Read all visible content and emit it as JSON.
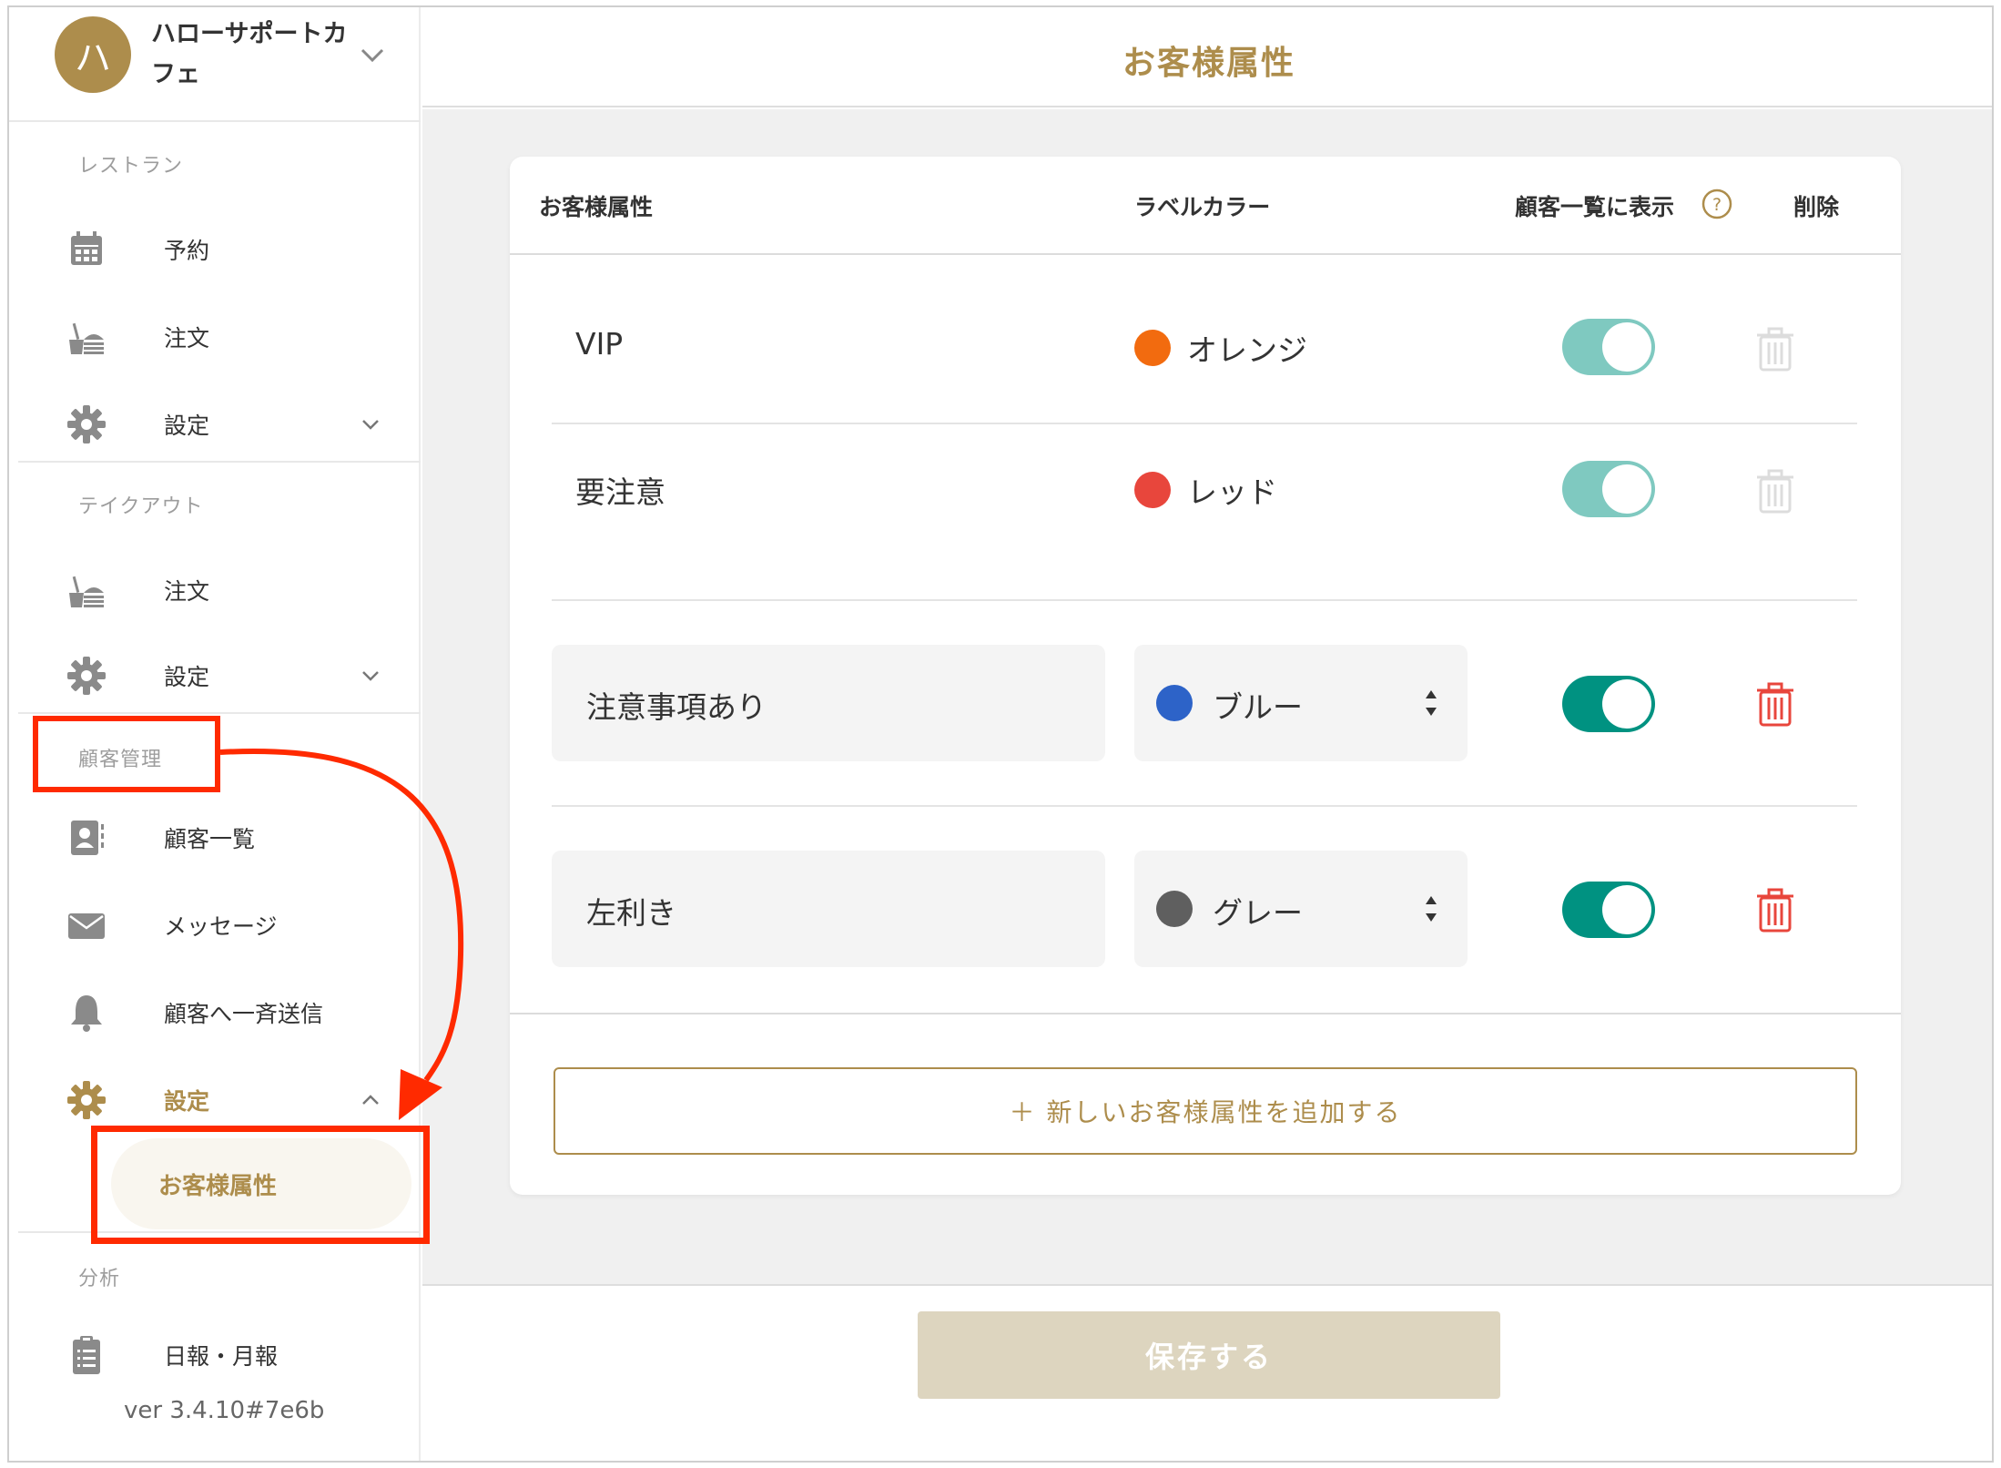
{
  "brand": {
    "avatar_letter": "ハ",
    "name": "ハローサポートカフェ"
  },
  "sidebar": {
    "sections": [
      {
        "title": "レストラン",
        "items": [
          "予約",
          "注文",
          "設定"
        ]
      },
      {
        "title": "テイクアウト",
        "items": [
          "注文",
          "設定"
        ]
      },
      {
        "title": "顧客管理",
        "items": [
          "顧客一覧",
          "メッセージ",
          "顧客へ一斉送信",
          "設定"
        ]
      },
      {
        "title": "分析",
        "items": [
          "日報・月報"
        ]
      }
    ],
    "active_sub_item": "お客様属性",
    "version": "ver 3.4.10#7e6b"
  },
  "page": {
    "title": "お客様属性"
  },
  "table": {
    "headers": {
      "attribute": "お客様属性",
      "color": "ラベルカラー",
      "show_in_list": "顧客一覧に表示",
      "delete": "削除"
    },
    "rows": [
      {
        "name": "VIP",
        "color_name": "オレンジ",
        "color": "#f26b0f",
        "show": true,
        "editable": false
      },
      {
        "name": "要注意",
        "color_name": "レッド",
        "color": "#e8463c",
        "show": true,
        "editable": false
      },
      {
        "name": "注意事項あり",
        "color_name": "ブルー",
        "color": "#2d63c8",
        "show": true,
        "editable": true
      },
      {
        "name": "左利き",
        "color_name": "グレー",
        "color": "#5f5f5f",
        "show": true,
        "editable": true
      }
    ]
  },
  "add_button": {
    "label": "＋ 新しいお客様属性を追加する"
  },
  "save_button": {
    "label": "保存する"
  },
  "colors": {
    "accent": "#ad8d4c",
    "toggle_on": "#009281",
    "toggle_on_disabled": "#7fc9c0",
    "delete": "#e8463c",
    "highlight": "#ff2a00"
  }
}
